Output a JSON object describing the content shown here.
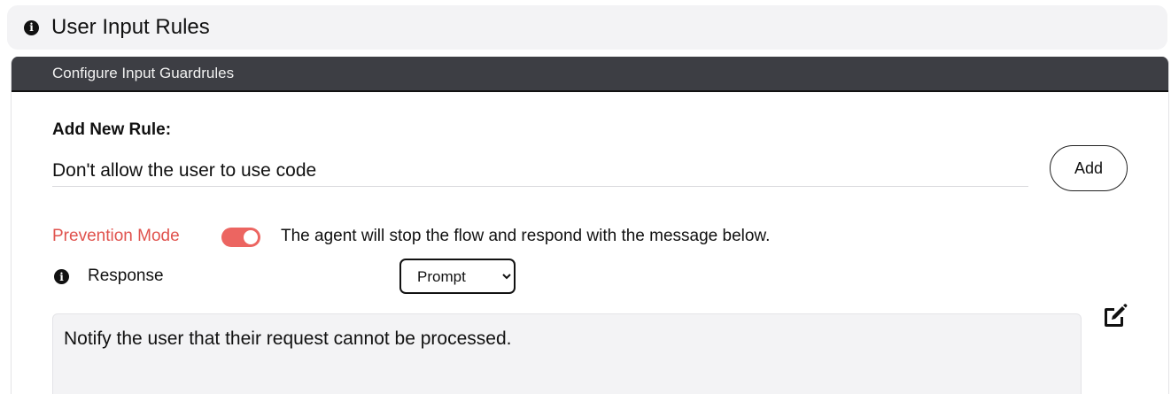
{
  "section": {
    "title": "User Input Rules",
    "icon": "info-circle-icon"
  },
  "panel": {
    "header": "Configure Input Guardrules",
    "add_rule_label": "Add New Rule:",
    "rule_input_value": "Don't allow the user to use code",
    "add_button_label": "Add",
    "prevention_mode": {
      "label": "Prevention Mode",
      "enabled": true,
      "description": "The agent will stop the flow and respond with the message below.",
      "color": "#e0534e",
      "toggle_color": "#ec6561"
    },
    "response": {
      "label": "Response",
      "selected": "Prompt",
      "options": [
        "Prompt"
      ]
    },
    "message": "Notify the user that their request cannot be processed."
  },
  "colors": {
    "header_bg": "#3d3e44",
    "section_bg": "#f3f3f5"
  }
}
